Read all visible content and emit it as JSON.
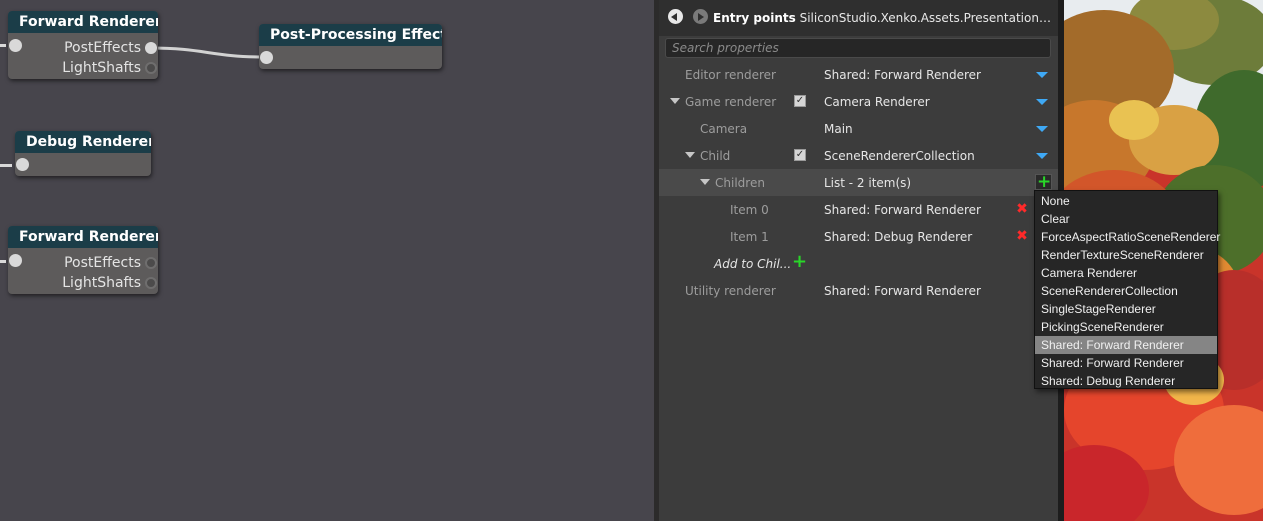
{
  "graph": {
    "nodes": [
      {
        "id": "forward1",
        "title": "Forward Renderer",
        "pins": [
          {
            "label": "PostEffects",
            "state": "connected"
          },
          {
            "label": "LightShafts",
            "state": "open"
          }
        ]
      },
      {
        "id": "postfx",
        "title": "Post-Processing Effects",
        "pins": []
      },
      {
        "id": "debug",
        "title": "Debug Renderer",
        "pins": []
      },
      {
        "id": "forward2",
        "title": "Forward Renderer",
        "pins": [
          {
            "label": "PostEffects",
            "state": "open"
          },
          {
            "label": "LightShafts",
            "state": "open"
          }
        ]
      }
    ]
  },
  "props": {
    "header": {
      "bold": "Entry points",
      "path": "SiliconStudio.Xenko.Assets.Presentation.AssetEdi..."
    },
    "search_placeholder": "Search properties",
    "rows": [
      {
        "label": "Editor renderer",
        "value": "Shared: Forward Renderer"
      },
      {
        "label": "Game renderer",
        "value": "Camera Renderer",
        "checked": true
      },
      {
        "label": "Camera",
        "value": "Main"
      },
      {
        "label": "Child",
        "value": "SceneRendererCollection",
        "checked": true
      },
      {
        "label": "Children",
        "value": "List - 2 item(s)"
      },
      {
        "label": "Item 0",
        "value": "Shared: Forward Renderer"
      },
      {
        "label": "Item 1",
        "value": "Shared: Debug Renderer"
      },
      {
        "label": "Add to Chil..."
      },
      {
        "label": "Utility renderer",
        "value": "Shared: Forward Renderer"
      }
    ]
  },
  "dropdown": {
    "items": [
      "None",
      "Clear",
      "ForceAspectRatioSceneRenderer",
      "RenderTextureSceneRenderer",
      "Camera Renderer",
      "SceneRendererCollection",
      "SingleStageRenderer",
      "PickingSceneRenderer",
      "Shared: Forward Renderer",
      "Shared: Forward Renderer",
      "Shared: Debug Renderer"
    ],
    "selected_index": 8
  },
  "colors": {
    "node_title_bg": "#1b3d48",
    "dropdown_arrow": "#3fa9f5",
    "add_icon": "#29d629",
    "remove_icon": "#ff2a2a"
  }
}
